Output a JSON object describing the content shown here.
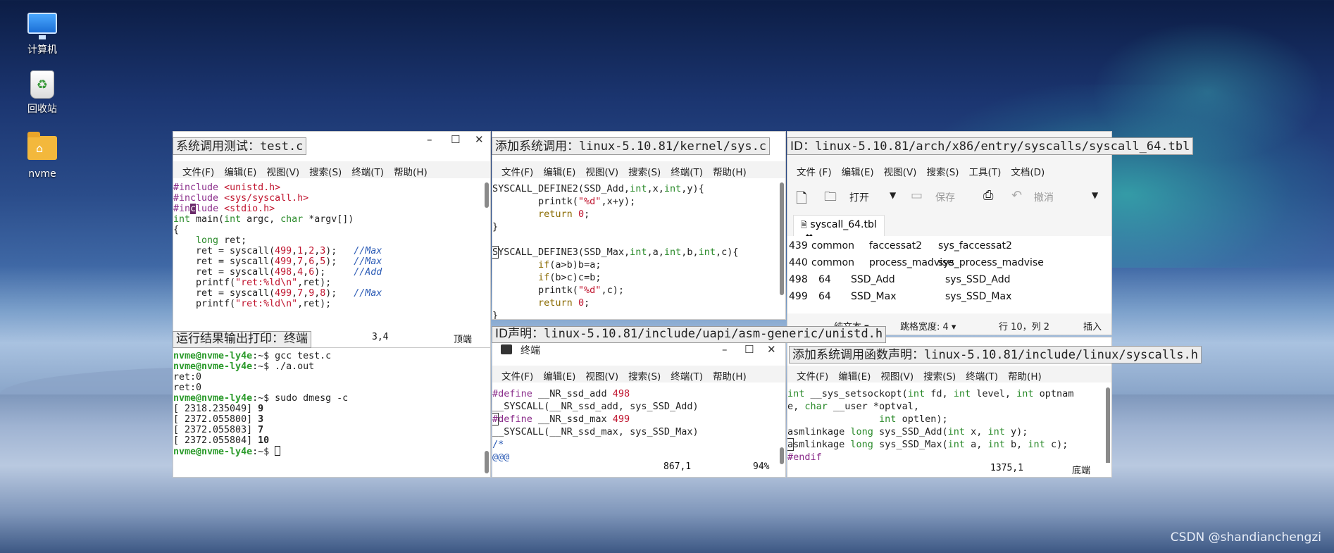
{
  "desktop": {
    "icons": [
      {
        "label": "计算机"
      },
      {
        "label": "回收站"
      },
      {
        "label": "nvme"
      }
    ],
    "watermark": "CSDN @shandianchengzi"
  },
  "win1": {
    "caption": "系统调用测试：",
    "file": "test.c",
    "menu": [
      "文件(F)",
      "编辑(E)",
      "视图(V)",
      "搜索(S)",
      "终端(T)",
      "帮助(H)"
    ],
    "status": {
      "pos": "3,4",
      "where": "顶端"
    }
  },
  "win2": {
    "caption": "添加系统调用：",
    "path": "linux-5.10.81/kernel/sys.c",
    "menu": [
      "文件(F)",
      "编辑(E)",
      "视图(V)",
      "搜索(S)",
      "终端(T)",
      "帮助(H)"
    ]
  },
  "win3": {
    "caption": "ID：",
    "path": "linux-5.10.81/arch/x86/entry/syscalls/syscall_64.tbl",
    "menu": [
      "文件 (F)",
      "编辑(E)",
      "视图(V)",
      "搜索(S)",
      "工具(T)",
      "文档(D)"
    ],
    "toolbar": {
      "open": "打开",
      "save": "保存",
      "undo": "撤消"
    },
    "tab": "syscall_64.tbl",
    "rows": [
      [
        "439",
        "common",
        "faccessat2",
        "sys_faccessat2"
      ],
      [
        "440",
        "common",
        "process_madvise",
        "sys_process_madvise"
      ],
      [
        "498",
        "64",
        "SSD_Add",
        "sys_SSD_Add"
      ],
      [
        "499",
        "64",
        "SSD_Max",
        "sys_SSD_Max"
      ]
    ],
    "status": {
      "lang": "纯文本",
      "tab": "跳格宽度: 4",
      "pos": "行 10，列 2",
      "mode": "插入"
    }
  },
  "win4": {
    "caption": "运行结果输出打印：终端",
    "lines": [
      {
        "p": "nvme@nvme-ly4e",
        "c": ":~$ gcc test.c"
      },
      {
        "p": "nvme@nvme-ly4e",
        "c": ":~$ ./a.out"
      },
      {
        "t": "ret:0"
      },
      {
        "t": "ret:0"
      },
      {
        "p": "nvme@nvme-ly4e",
        "c": ":~$ sudo dmesg -c"
      },
      {
        "ts": "[ 2318.235049]",
        "v": "9"
      },
      {
        "ts": "[ 2372.055800]",
        "v": "3"
      },
      {
        "ts": "[ 2372.055803]",
        "v": "7"
      },
      {
        "ts": "[ 2372.055804]",
        "v": "10"
      },
      {
        "p": "nvme@nvme-ly4e",
        "c": ":~$ "
      }
    ]
  },
  "win5": {
    "caption": "ID声明：",
    "path": "linux-5.10.81/include/uapi/asm-generic/unistd.h",
    "title": "终端",
    "menu": [
      "文件(F)",
      "编辑(E)",
      "视图(V)",
      "搜索(S)",
      "终端(T)",
      "帮助(H)"
    ],
    "status": {
      "pos": "867,1",
      "pct": "94%"
    }
  },
  "win6": {
    "caption": "添加系统调用函数声明：",
    "path": "linux-5.10.81/include/linux/syscalls.h",
    "menu": [
      "文件(F)",
      "编辑(E)",
      "视图(V)",
      "搜索(S)",
      "终端(T)",
      "帮助(H)"
    ],
    "status": {
      "pos": "1375,1",
      "where": "底端"
    }
  }
}
